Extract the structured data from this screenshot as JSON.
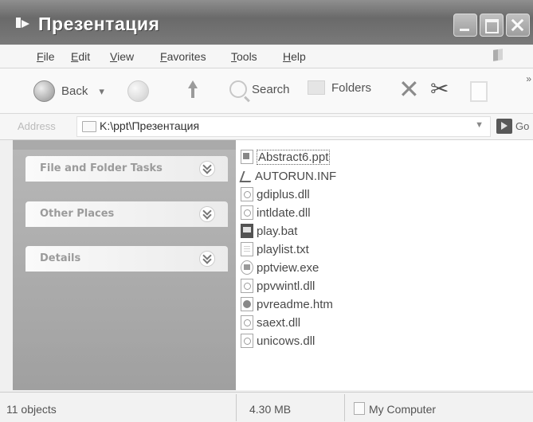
{
  "window": {
    "title": "Презентация"
  },
  "menu": [
    "File",
    "Edit",
    "View",
    "Favorites",
    "Tools",
    "Help"
  ],
  "toolbar": {
    "back": "Back",
    "search": "Search",
    "folders": "Folders"
  },
  "address": {
    "label": "Address",
    "path": "K:\\ppt\\Презентация",
    "go": "Go"
  },
  "taskpane": {
    "sections": [
      "File and Folder Tasks",
      "Other Places",
      "Details"
    ]
  },
  "files": [
    {
      "name": "Abstract6.ppt",
      "icon": "ppt-file-icon",
      "selected": true
    },
    {
      "name": "AUTORUN.INF",
      "icon": "inf-file-icon"
    },
    {
      "name": "gdiplus.dll",
      "icon": "dll-file-icon"
    },
    {
      "name": "intldate.dll",
      "icon": "dll-file-icon"
    },
    {
      "name": "play.bat",
      "icon": "bat-file-icon"
    },
    {
      "name": "playlist.txt",
      "icon": "txt-file-icon"
    },
    {
      "name": "pptview.exe",
      "icon": "exe-file-icon"
    },
    {
      "name": "ppvwintl.dll",
      "icon": "dll-file-icon"
    },
    {
      "name": "pvreadme.htm",
      "icon": "htm-file-icon"
    },
    {
      "name": "saext.dll",
      "icon": "dll-file-icon"
    },
    {
      "name": "unicows.dll",
      "icon": "dll-file-icon"
    }
  ],
  "status": {
    "objects": "11 objects",
    "size": "4.30 MB",
    "location": "My Computer"
  }
}
